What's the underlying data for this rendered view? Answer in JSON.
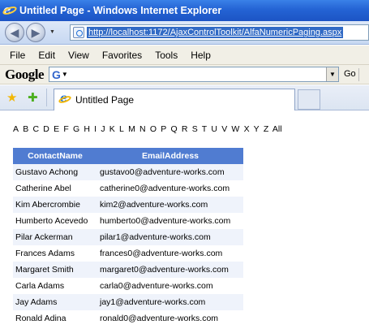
{
  "window": {
    "title": "Untitled Page - Windows Internet Explorer"
  },
  "address": {
    "url": "http://localhost:1172/AjaxControlToolkit/AlfaNumericPaging.aspx"
  },
  "menu": [
    "File",
    "Edit",
    "View",
    "Favorites",
    "Tools",
    "Help"
  ],
  "google": {
    "logo": "Google",
    "go": "Go"
  },
  "tab": {
    "title": "Untitled Page"
  },
  "alphabet": [
    "A",
    "B",
    "C",
    "D",
    "E",
    "F",
    "G",
    "H",
    "I",
    "J",
    "K",
    "L",
    "M",
    "N",
    "O",
    "P",
    "Q",
    "R",
    "S",
    "T",
    "U",
    "V",
    "W",
    "X",
    "Y",
    "Z",
    "All"
  ],
  "grid": {
    "headers": [
      "ContactName",
      "EmailAddress"
    ],
    "rows": [
      [
        "Gustavo Achong",
        "gustavo0@adventure-works.com"
      ],
      [
        "Catherine Abel",
        "catherine0@adventure-works.com"
      ],
      [
        "Kim Abercrombie",
        "kim2@adventure-works.com"
      ],
      [
        "Humberto Acevedo",
        "humberto0@adventure-works.com"
      ],
      [
        "Pilar Ackerman",
        "pilar1@adventure-works.com"
      ],
      [
        "Frances Adams",
        "frances0@adventure-works.com"
      ],
      [
        "Margaret Smith",
        "margaret0@adventure-works.com"
      ],
      [
        "Carla Adams",
        "carla0@adventure-works.com"
      ],
      [
        "Jay Adams",
        "jay1@adventure-works.com"
      ],
      [
        "Ronald Adina",
        "ronald0@adventure-works.com"
      ]
    ]
  },
  "colors": {
    "header_bg": "#507cd1",
    "alt_row_bg": "#eff3fb",
    "titlebar": "#2463d4"
  }
}
